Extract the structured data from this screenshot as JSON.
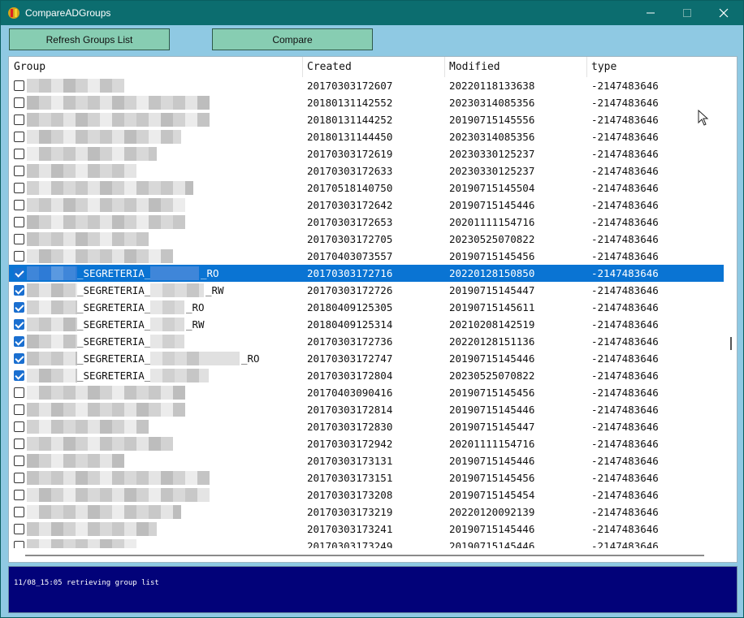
{
  "window": {
    "title": "CompareADGroups",
    "icon": "app-icon",
    "controls": [
      "minimize-icon",
      "maximize-icon",
      "close-icon"
    ]
  },
  "toolbar": {
    "refresh_label": "Refresh Groups List",
    "compare_label": "Compare"
  },
  "table": {
    "columns": [
      "Group",
      "Created",
      "Modified",
      "type"
    ],
    "rows": [
      {
        "checked": false,
        "group": "",
        "created": "20170303172607",
        "modified": "20220118133638",
        "type": "-2147483646"
      },
      {
        "checked": false,
        "group": "",
        "created": "20180131142552",
        "modified": "20230314085356",
        "type": "-2147483646"
      },
      {
        "checked": false,
        "group": "",
        "created": "20180131144252",
        "modified": "20190715145556",
        "type": "-2147483646"
      },
      {
        "checked": false,
        "group": "",
        "created": "20180131144450",
        "modified": "20230314085356",
        "type": "-2147483646"
      },
      {
        "checked": false,
        "group": "",
        "created": "20170303172619",
        "modified": "20230330125237",
        "type": "-2147483646"
      },
      {
        "checked": false,
        "group": "",
        "created": "20170303172633",
        "modified": "20230330125237",
        "type": "-2147483646"
      },
      {
        "checked": false,
        "group": "",
        "created": "20170518140750",
        "modified": "20190715145504",
        "type": "-2147483646"
      },
      {
        "checked": false,
        "group": "",
        "created": "20170303172642",
        "modified": "20190715145446",
        "type": "-2147483646"
      },
      {
        "checked": false,
        "group": "",
        "created": "20170303172653",
        "modified": "20201111154716",
        "type": "-2147483646"
      },
      {
        "checked": false,
        "group": "",
        "created": "20170303172705",
        "modified": "20230525070822",
        "type": "-2147483646"
      },
      {
        "checked": false,
        "group": "",
        "created": "20170403073557",
        "modified": "20190715145456",
        "type": "-2147483646"
      },
      {
        "checked": true,
        "selected": true,
        "group": "_SEGRETERIA_",
        "suffix": "_RO",
        "created": "20170303172716",
        "modified": "20220128150850",
        "type": "-2147483646"
      },
      {
        "checked": true,
        "group": "_SEGRETERIA_",
        "suffix": "_RW",
        "created": "20170303172726",
        "modified": "20190715145447",
        "type": "-2147483646"
      },
      {
        "checked": true,
        "group": "_SEGRETERIA_",
        "suffix": "_RO",
        "created": "20180409125305",
        "modified": "20190715145611",
        "type": "-2147483646"
      },
      {
        "checked": true,
        "group": "_SEGRETERIA_",
        "suffix": "_RW",
        "created": "20180409125314",
        "modified": "20210208142519",
        "type": "-2147483646"
      },
      {
        "checked": true,
        "group": "_SEGRETERIA_",
        "suffix": "",
        "created": "20170303172736",
        "modified": "20220128151136",
        "type": "-2147483646"
      },
      {
        "checked": true,
        "group": "_SEGRETERIA_",
        "suffix": "_RO",
        "created": "20170303172747",
        "modified": "20190715145446",
        "type": "-2147483646"
      },
      {
        "checked": true,
        "group": "_SEGRETERIA_",
        "suffix": "",
        "created": "20170303172804",
        "modified": "20230525070822",
        "type": "-2147483646"
      },
      {
        "checked": false,
        "group": "",
        "created": "20170403090416",
        "modified": "20190715145456",
        "type": "-2147483646"
      },
      {
        "checked": false,
        "group": "",
        "created": "20170303172814",
        "modified": "20190715145446",
        "type": "-2147483646"
      },
      {
        "checked": false,
        "group": "",
        "created": "20170303172830",
        "modified": "20190715145447",
        "type": "-2147483646"
      },
      {
        "checked": false,
        "group": "",
        "created": "20170303172942",
        "modified": "20201111154716",
        "type": "-2147483646"
      },
      {
        "checked": false,
        "group": "",
        "created": "20170303173131",
        "modified": "20190715145446",
        "type": "-2147483646"
      },
      {
        "checked": false,
        "group": "",
        "created": "20170303173151",
        "modified": "20190715145456",
        "type": "-2147483646"
      },
      {
        "checked": false,
        "group": "",
        "created": "20170303173208",
        "modified": "20190715145454",
        "type": "-2147483646"
      },
      {
        "checked": false,
        "group": "",
        "created": "20170303173219",
        "modified": "20220120092139",
        "type": "-2147483646"
      },
      {
        "checked": false,
        "group": "",
        "created": "20170303173241",
        "modified": "20190715145446",
        "type": "-2147483646"
      },
      {
        "checked": false,
        "group": "",
        "created": "20170303173249",
        "modified": "20190715145446",
        "type": "-2147483646"
      }
    ]
  },
  "log": {
    "text": "11/08_15:05 retrieving group list"
  },
  "colors": {
    "titlebar": "#0c6d6f",
    "background": "#8fc9e3",
    "button": "#87cdb2",
    "selection": "#0a74d3",
    "log_bg": "#020279"
  }
}
